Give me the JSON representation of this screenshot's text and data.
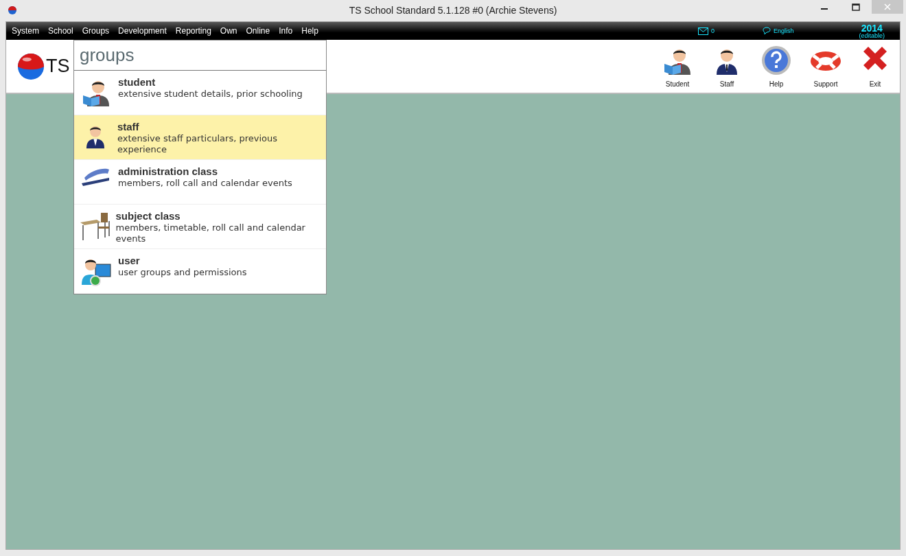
{
  "window": {
    "title": "TS School Standard 5.1.128 #0 (Archie Stevens)"
  },
  "menu": [
    "System",
    "School",
    "Groups",
    "Development",
    "Reporting",
    "Own",
    "Online",
    "Info",
    "Help"
  ],
  "status": {
    "messages": "0",
    "language": "English",
    "year": "2014",
    "year_note": "(editable)"
  },
  "logo": {
    "text": "TS"
  },
  "toolbar": [
    "Student",
    "Staff",
    "Help",
    "Support",
    "Exit"
  ],
  "dropdown": {
    "title": "groups",
    "items": [
      {
        "title": "student",
        "description": "extensive student details, prior schooling",
        "selected": false
      },
      {
        "title": "staff",
        "description": "extensive staff particulars, previous experience",
        "selected": true
      },
      {
        "title": "administration class",
        "description": "members, roll call and calendar events",
        "selected": false
      },
      {
        "title": "subject class",
        "description": "members, timetable, roll call and calendar events",
        "selected": false
      },
      {
        "title": "user",
        "description": "user groups and permissions",
        "selected": false
      }
    ]
  }
}
